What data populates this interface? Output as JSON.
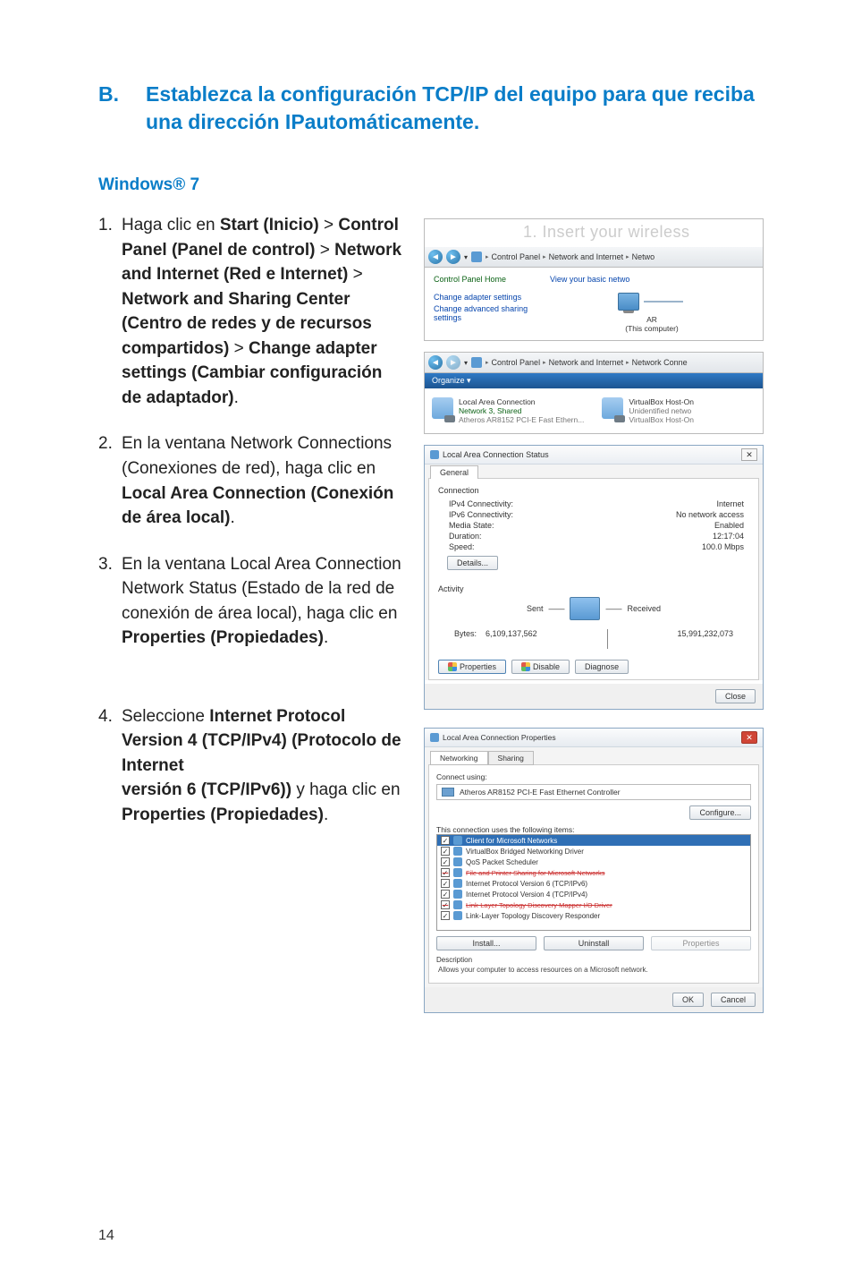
{
  "page_number": "14",
  "section": {
    "letter": "B.",
    "title": "Establezca la configuración TCP/IP del equipo para que reciba una dirección IPautomáticamente."
  },
  "subheading": "Windows® 7",
  "steps": {
    "s1": {
      "pre": "Haga clic en ",
      "b1": "Start (Inicio)",
      "t1": " > ",
      "b2": "Control Panel (Panel de control)",
      "t2": " > ",
      "b3": "Network and Internet (Red e Internet)",
      "t3": " > ",
      "b4": "Network and Sharing Center (Centro de redes y de recursos compartidos)",
      "t4": " > ",
      "b5": "Change adapter settings (Cambiar configuración de adaptador)",
      "post": "."
    },
    "s2": {
      "t1": "En la ventana Network Connections (Conexiones de red), haga clic en ",
      "b1": "Local Area Connection (Conexión de área local)",
      "post": "."
    },
    "s3": {
      "t1": "En la ventana Local Area Connection Network Status (Estado de la red de conexión de área local), haga clic en ",
      "b1": "Properties (Propiedades)",
      "post": "."
    },
    "s4": {
      "t1": "Seleccione ",
      "b1": "Internet Protocol Version 4 (TCP/IPv4) (Protocolo de Internet",
      "br": " ",
      "b2": "versión 6 (TCP/IPv6))",
      "t2": " y haga clic en ",
      "b3": "Properties (Propiedades)",
      "post": "."
    }
  },
  "panel1": {
    "watermark": "1. Insert your wireless",
    "bc1": "Control Panel",
    "bc2": "Network and Internet",
    "bc3": "Netwo",
    "home": "Control Panel Home",
    "link1": "Change adapter settings",
    "link2": "Change advanced sharing settings",
    "view": "View your basic netwo",
    "ar": "AR",
    "this": "(This computer)"
  },
  "panel2": {
    "bc1": "Control Panel",
    "bc2": "Network and Internet",
    "bc3": "Network Conne",
    "organize": "Organize ▾",
    "c1_name": "Local Area Connection",
    "c1_status": "Network 3, Shared",
    "c1_dev": "Atheros AR8152 PCI-E Fast Ethern...",
    "c2_name": "VirtualBox Host-On",
    "c2_status": "Unidentified netwo",
    "c2_dev": "VirtualBox Host-On"
  },
  "status": {
    "title": "Local Area Connection Status",
    "tab": "General",
    "conn_label": "Connection",
    "rows": {
      "ipv4_k": "IPv4 Connectivity:",
      "ipv4_v": "Internet",
      "ipv6_k": "IPv6 Connectivity:",
      "ipv6_v": "No network access",
      "media_k": "Media State:",
      "media_v": "Enabled",
      "dur_k": "Duration:",
      "dur_v": "12:17:04",
      "spd_k": "Speed:",
      "spd_v": "100.0 Mbps"
    },
    "details": "Details...",
    "activity_label": "Activity",
    "sent": "Sent",
    "received": "Received",
    "bytes_label": "Bytes:",
    "bytes_sent": "6,109,137,562",
    "bytes_recv": "15,991,232,073",
    "properties": "Properties",
    "disable": "Disable",
    "diagnose": "Diagnose",
    "close": "Close"
  },
  "props": {
    "title": "Local Area Connection Properties",
    "tab1": "Networking",
    "tab2": "Sharing",
    "connect_using": "Connect using:",
    "adapter": "Atheros AR8152 PCI-E Fast Ethernet Controller",
    "configure": "Configure...",
    "uses": "This connection uses the following items:",
    "items": [
      "Client for Microsoft Networks",
      "VirtualBox Bridged Networking Driver",
      "QoS Packet Scheduler",
      "File and Printer Sharing for Microsoft Networks",
      "Internet Protocol Version 6 (TCP/IPv6)",
      "Internet Protocol Version 4 (TCP/IPv4)",
      "Link-Layer Topology Discovery Mapper I/O Driver",
      "Link-Layer Topology Discovery Responder"
    ],
    "install": "Install...",
    "uninstall": "Uninstall",
    "properties": "Properties",
    "desc_label": "Description",
    "desc_text": "Allows your computer to access resources on a Microsoft network.",
    "ok": "OK",
    "cancel": "Cancel"
  }
}
